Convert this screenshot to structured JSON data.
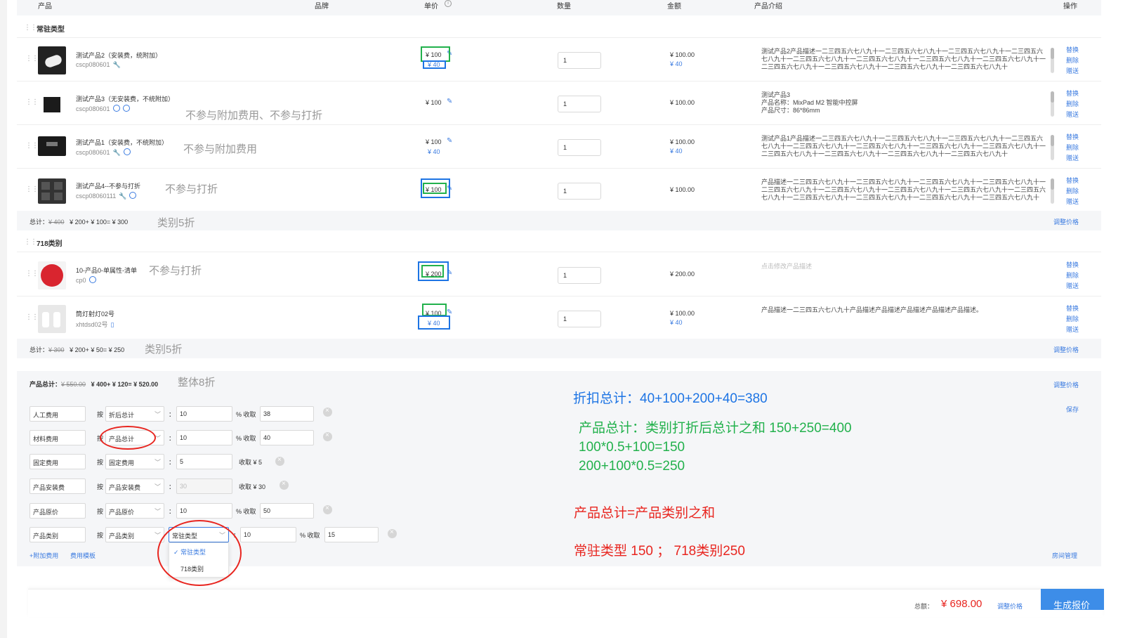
{
  "header": {
    "product": "产品",
    "brand": "品牌",
    "unit_price": "单价",
    "quantity": "数量",
    "amount": "金额",
    "intro": "产品介绍",
    "ops": "操作"
  },
  "ops": {
    "replace": "替换",
    "delete": "删除",
    "gift": "赠送"
  },
  "group1": {
    "name": "常驻类型",
    "rows": [
      {
        "name": "测试产品2（安装费，统附加）",
        "code": "cscp080601",
        "price": "¥ 100",
        "price2": "¥ 40",
        "qty": "1",
        "amount": "¥ 100.00",
        "amount2": "¥ 40",
        "desc": "测试产品2产品描述一二三四五六七八九十一二三四五六七八九十一二三四五六七八九十一二三四五六七八九十一二三四五六七八九十一二三四五六七八九十一二三四五六七八九十一二三四五六七八九十一二三四五六七八九十一二三四五六七八九十一二三四五六七八九十一二三四五六七八九十"
      },
      {
        "name": "测试产品3（无安装费，不统附加）",
        "code": "cscp080601",
        "price": "¥ 100",
        "qty": "1",
        "amount": "¥ 100.00",
        "desc_l1": "测试产品3",
        "desc_l2": "产品名称：MixPad M2 智能中控屏",
        "desc_l3": "产品尺寸：86*86mm",
        "note": "不参与附加费用、不参与打折"
      },
      {
        "name": "测试产品1（安装费，不统附加）",
        "code": "cscp080601",
        "price": "¥ 100",
        "price2": "¥ 40",
        "qty": "1",
        "amount": "¥ 100.00",
        "amount2": "¥ 40",
        "desc": "测试产品1产品描述一二三四五六七八九十一二三四五六七八九十一二三四五六七八九十一二三四五六七八九十一二三四五六七八九十一二三四五六七八九十一二三四五六七八九十一二三四五六七八九十一二三四五六七八九十一二三四五六七八九十一二三四五六七八九十一二三四五六七八九十",
        "note": "不参与附加费用"
      },
      {
        "name": "测试产品4--不参与打折",
        "code": "cscp08060111",
        "price": "¥ 100",
        "qty": "1",
        "amount": "¥ 100.00",
        "desc": "产品描述一二三四五六七八九十一二三四五六七八九十一二三四五六七八九十一二三四五六七八九十一二三四五六七八九十一二三四五六七八九十一二三四五六七八九十一二三四五六七八九十一二三四五六七八九十一二三四五六七八九十一二三四五六七八九十一二三四五六七八九十一二三四五六七八九十",
        "note": "不参与打折"
      }
    ],
    "total_label": "总计：",
    "total_strike": "¥ 400",
    "total_calc": "¥ 200+ ¥ 100= ¥ 300",
    "total_note": "类别5折",
    "adjust": "调整价格"
  },
  "group2": {
    "name": "718类别",
    "rows": [
      {
        "name": "10-产品0-单属性-清单",
        "code": "cp0",
        "price": "¥ 200",
        "qty": "1",
        "amount": "¥ 200.00",
        "desc_placeholder": "点击修改产品描述",
        "note": "不参与打折"
      },
      {
        "name": "筒灯射灯02号",
        "code": "xhtdsd02号",
        "price": "¥ 100",
        "price2": "¥ 40",
        "qty": "1",
        "amount": "¥ 100.00",
        "amount2": "¥ 40",
        "desc": "产品描述一二三四五六七八九十产品描述产品描述产品描述产品描述产品描述。"
      }
    ],
    "total_label": "总计：",
    "total_strike": "¥ 300",
    "total_calc": "¥ 200+ ¥ 50= ¥ 250",
    "total_note": "类别5折",
    "adjust": "调整价格"
  },
  "fees": {
    "product_total_label": "产品总计：",
    "product_total_strike": "¥ 550.00",
    "product_total_calc": "¥ 400+ ¥ 120= ¥ 520.00",
    "product_total_note": "整体8折",
    "adjust": "调整价格",
    "save": "保存",
    "by": "按",
    "colon": "：",
    "pct_collect": "% 收取",
    "rows": [
      {
        "name": "人工费用",
        "basis": "折后总计",
        "rate": "10",
        "collect": "38"
      },
      {
        "name": "材料费用",
        "basis": "产品总计",
        "rate": "10",
        "collect": "40"
      },
      {
        "name": "固定费用",
        "basis": "固定费用",
        "rate": "5",
        "fixed": "收取 ¥ 5"
      },
      {
        "name": "产品安装费",
        "basis": "产品安装费",
        "rate": "30",
        "fixed": "收取 ¥ 30"
      },
      {
        "name": "产品原价",
        "basis": "产品原价",
        "rate": "10",
        "collect": "50"
      },
      {
        "name": "产品类别",
        "basis": "产品类别",
        "category": "常驻类型",
        "rate": "10",
        "collect": "15"
      }
    ],
    "dropdown": {
      "opt1": "常驻类型",
      "opt2": "718类别"
    },
    "add_fee": "+附加费用",
    "fee_template": "费用模板",
    "room_manage": "房间管理"
  },
  "annotations": {
    "discount_total": "折扣总计：40+100+200+40=380",
    "green1": "产品总计：类别打折后总计之和  150+250=400",
    "green2": "100*0.5+100=150",
    "green3": "200+100*0.5=250",
    "red1": "产品总计=产品类别之和",
    "red2": "常驻类型  150  ；  718类别250"
  },
  "footer": {
    "total_label": "总额：",
    "total_value": "¥ 698.00",
    "adjust": "调整价格",
    "generate": "生成报价"
  },
  "colors": {
    "accent": "#3b7be0",
    "annotation_green": "#22b14c",
    "annotation_blue": "#1d74e4",
    "annotation_red": "#e8251f",
    "price_red": "#e8251f"
  }
}
